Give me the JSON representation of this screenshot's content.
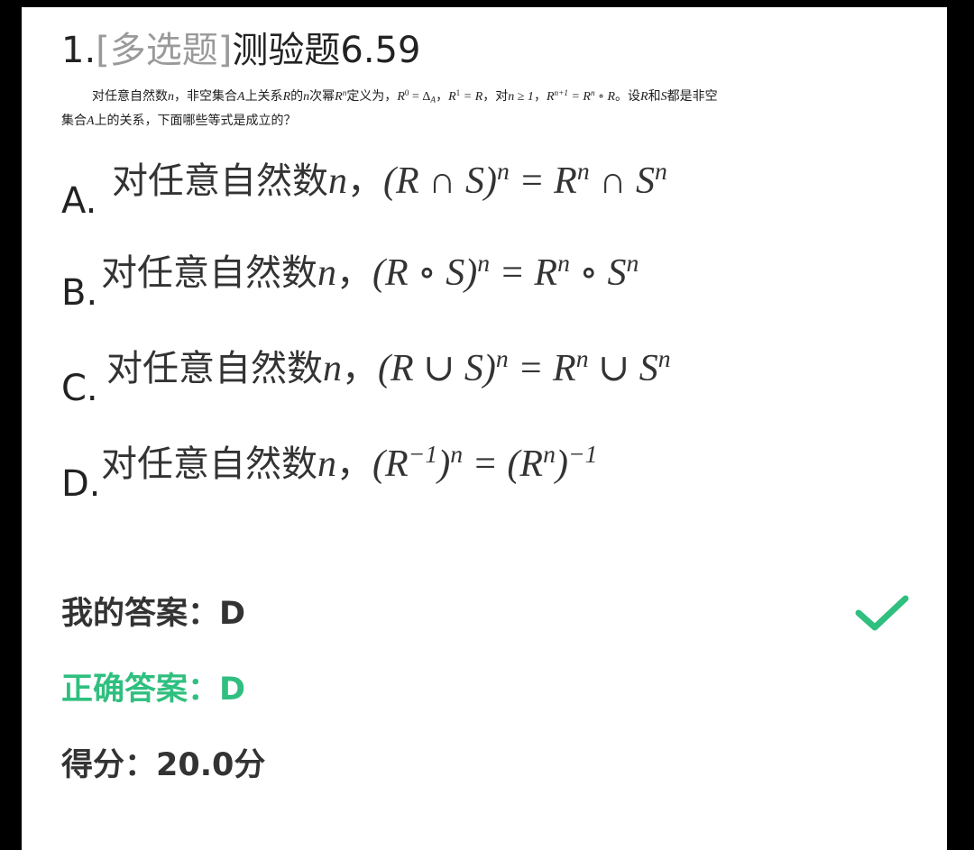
{
  "question": {
    "number": "1.",
    "type_tag": "[多选题]",
    "title": "测验题6.59",
    "stem": {
      "t1": "对任意自然数",
      "v_n": "n",
      "t2": "，非空集合",
      "v_A": "A",
      "t3": "上关系",
      "v_R": "R",
      "t4": "的",
      "t5": "次幂",
      "t6": "定义为，",
      "eq1_lhs": "R",
      "eq1_sup": "0",
      "eq1_rhs": " = Δ",
      "eq1_sub": "A",
      "t7": "，",
      "eq2": "R",
      "eq2_sup": "1",
      "eq2_rhs": " = R",
      "t8": "，对",
      "eq3": "n ≥ 1",
      "t9": "，",
      "eq4_lhs": "R",
      "eq4_sup": "n+1",
      "eq4_rhs": " = R",
      "eq4_rsup": "n",
      "eq4_tail": " ∘ R",
      "t10": "。设",
      "t11": "和",
      "v_S": "S",
      "t12": "都是非空集合",
      "t13": "上的关系，下面哪些等式是成立的？"
    },
    "options": [
      {
        "letter": "A.",
        "prefix": "对任意自然数",
        "var": "n",
        "comma": "，",
        "p1": "(R ∩ S)",
        "s1": "n",
        "p2": " = R",
        "s2": "n",
        "p3": " ∩ S",
        "s3": "n",
        "p4": "",
        "s4": ""
      },
      {
        "letter": "B.",
        "prefix": "对任意自然数",
        "var": "n",
        "comma": "，",
        "p1": "(R ∘ S)",
        "s1": "n",
        "p2": " = R",
        "s2": "n",
        "p3": " ∘ S",
        "s3": "n",
        "p4": "",
        "s4": ""
      },
      {
        "letter": "C.",
        "prefix": "对任意自然数",
        "var": "n",
        "comma": "，",
        "p1": "(R ∪ S)",
        "s1": "n",
        "p2": " = R",
        "s2": "n",
        "p3": " ∪ S",
        "s3": "n",
        "p4": "",
        "s4": ""
      },
      {
        "letter": "D.",
        "prefix": "对任意自然数",
        "var": "n",
        "comma": "，",
        "p1": "(R",
        "s1": "−1",
        "p2": ")",
        "s2": "n",
        "p3": " = (R",
        "s3": "n",
        "p4": ")",
        "s4": "−1"
      }
    ]
  },
  "result": {
    "my_answer_label": "我的答案：",
    "my_answer": "D",
    "correct_answer_label": "正确答案：",
    "correct_answer": "D",
    "score_label": "得分：",
    "score_value": "20.0分",
    "status_icon": "check-icon"
  },
  "colors": {
    "background": "#000000",
    "card": "#ffffff",
    "tag_gray": "#9a9a9a",
    "correct_green": "#2fbf7f"
  }
}
